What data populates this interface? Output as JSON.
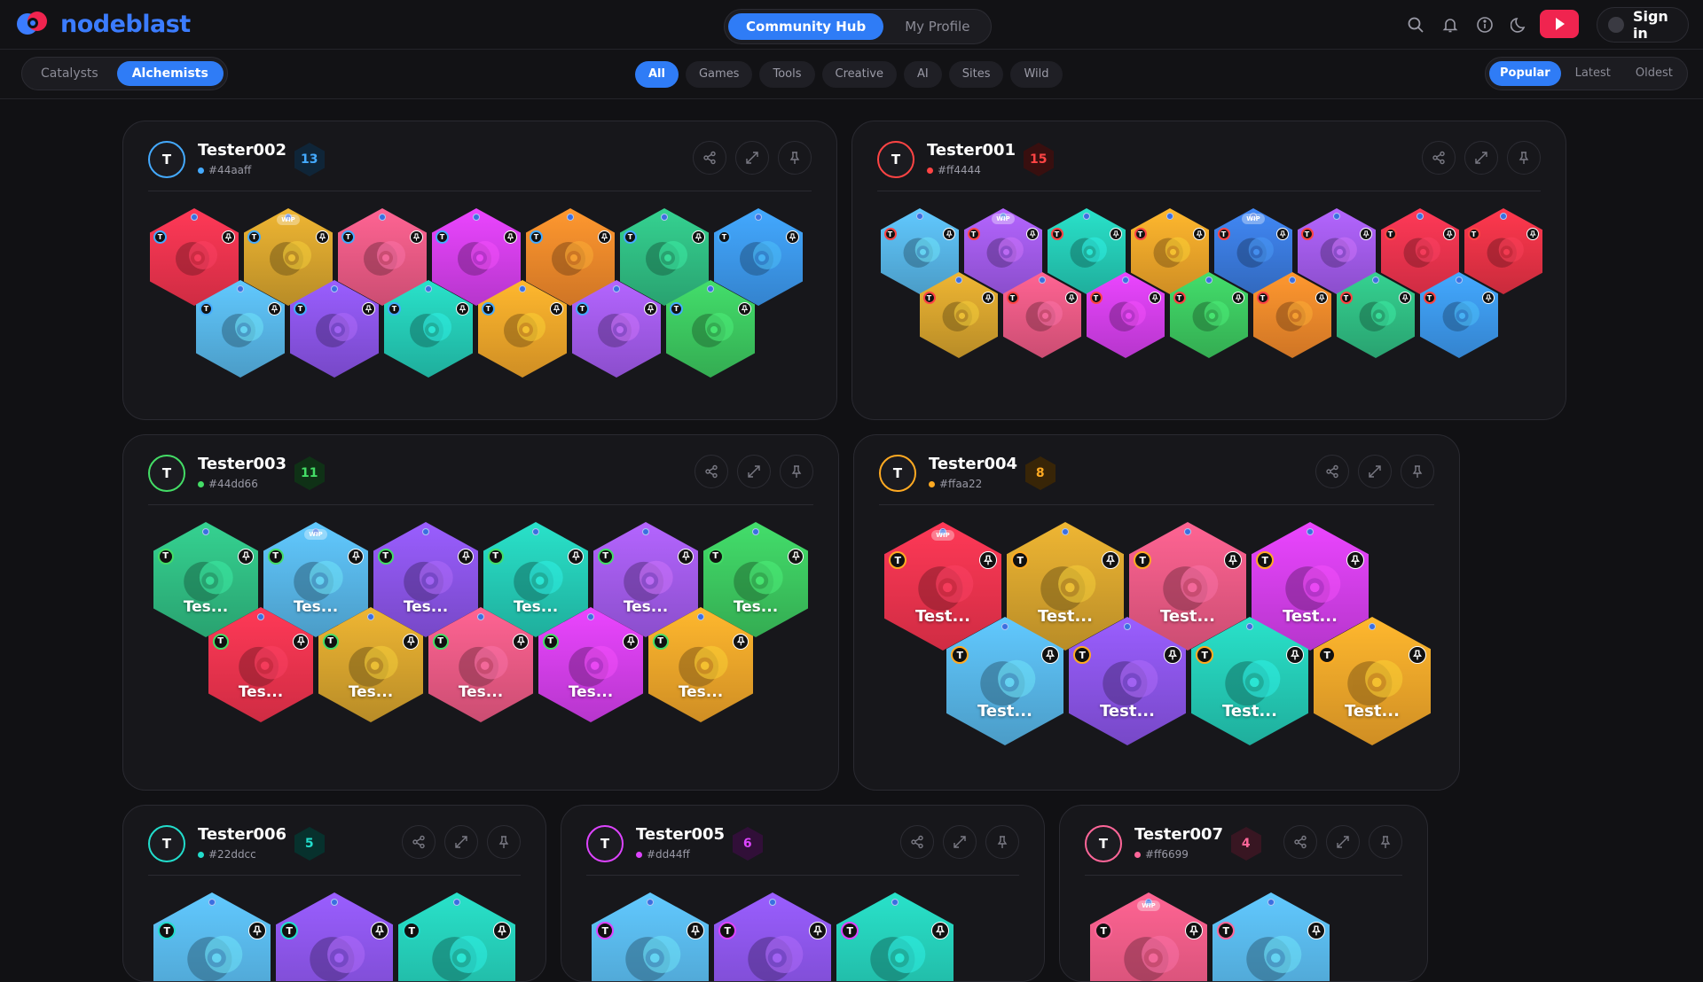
{
  "app": {
    "name": "nodeblast"
  },
  "header": {
    "tabs": [
      {
        "label": "Community Hub",
        "active": true
      },
      {
        "label": "My Profile",
        "active": false
      }
    ],
    "signin_label": "Sign in"
  },
  "roles": [
    {
      "label": "Catalysts",
      "active": false
    },
    {
      "label": "Alchemists",
      "active": true
    }
  ],
  "filters": [
    {
      "label": "All",
      "active": true
    },
    {
      "label": "Games",
      "active": false
    },
    {
      "label": "Tools",
      "active": false
    },
    {
      "label": "Creative",
      "active": false
    },
    {
      "label": "AI",
      "active": false
    },
    {
      "label": "Sites",
      "active": false
    },
    {
      "label": "Wild",
      "active": false
    }
  ],
  "sorts": [
    {
      "label": "Popular",
      "active": true
    },
    {
      "label": "Latest",
      "active": false
    },
    {
      "label": "Oldest",
      "active": false
    }
  ],
  "palette": {
    "red": "#f3344f",
    "gold": "#d9a52e",
    "pink": "#ef5b86",
    "magenta": "#d63ff0",
    "orange": "#f38a2b",
    "green": "#30bf84",
    "blue": "#3d9af2",
    "sky": "#58b7ea",
    "purple": "#8c55ea",
    "teal": "#25cdb8",
    "amber": "#f3a72a",
    "lime": "#3dca61",
    "violet": "#a45cf0",
    "royal": "#3b7ce0",
    "crimson": "#ec3347"
  },
  "cards": [
    {
      "user": "Tester002",
      "color": "#44aaff",
      "color_label": "#44aaff",
      "count": "13",
      "tiles": [
        {
          "c": "red"
        },
        {
          "c": "gold",
          "wip": true
        },
        {
          "c": "pink"
        },
        {
          "c": "magenta"
        },
        {
          "c": "orange"
        },
        {
          "c": "green"
        },
        {
          "c": "blue"
        },
        {
          "c": "sky"
        },
        {
          "c": "purple"
        },
        {
          "c": "teal"
        },
        {
          "c": "amber"
        },
        {
          "c": "violet"
        },
        {
          "c": "lime"
        }
      ]
    },
    {
      "user": "Tester001",
      "color": "#ff4444",
      "color_label": "#ff4444",
      "count": "15",
      "tiles": [
        {
          "c": "sky"
        },
        {
          "c": "violet",
          "wip": true
        },
        {
          "c": "teal"
        },
        {
          "c": "amber"
        },
        {
          "c": "royal",
          "wip": true
        },
        {
          "c": "violet"
        },
        {
          "c": "red"
        },
        {
          "c": "crimson"
        },
        {
          "c": "gold"
        },
        {
          "c": "pink"
        },
        {
          "c": "magenta"
        },
        {
          "c": "lime"
        },
        {
          "c": "orange"
        },
        {
          "c": "green"
        },
        {
          "c": "blue"
        }
      ]
    },
    {
      "user": "Tester003",
      "color": "#44dd66",
      "color_label": "#44dd66",
      "count": "11",
      "tiles": [
        {
          "c": "green",
          "t": "Tes..."
        },
        {
          "c": "sky",
          "t": "Tes...",
          "wip": true
        },
        {
          "c": "purple",
          "t": "Tes..."
        },
        {
          "c": "teal",
          "t": "Tes..."
        },
        {
          "c": "violet",
          "t": "Tes..."
        },
        {
          "c": "lime",
          "t": "Tes..."
        },
        {
          "c": "red",
          "t": "Tes..."
        },
        {
          "c": "gold",
          "t": "Tes..."
        },
        {
          "c": "pink",
          "t": "Tes..."
        },
        {
          "c": "magenta",
          "t": "Tes..."
        },
        {
          "c": "amber",
          "t": "Tes..."
        }
      ]
    },
    {
      "user": "Tester004",
      "color": "#ffaa22",
      "color_label": "#ffaa22",
      "count": "8",
      "tiles": [
        {
          "c": "red",
          "t": "Test...",
          "wip": true
        },
        {
          "c": "gold",
          "t": "Test..."
        },
        {
          "c": "pink",
          "t": "Test..."
        },
        {
          "c": "magenta",
          "t": "Test..."
        },
        {
          "c": "sky",
          "t": "Test..."
        },
        {
          "c": "purple",
          "t": "Test..."
        },
        {
          "c": "teal",
          "t": "Test..."
        },
        {
          "c": "amber",
          "t": "Test..."
        }
      ]
    },
    {
      "user": "Tester006",
      "color": "#22ddcc",
      "color_label": "#22ddcc",
      "count": "5",
      "tiles": [
        {
          "c": "sky"
        },
        {
          "c": "purple"
        },
        {
          "c": "teal"
        }
      ]
    },
    {
      "user": "Tester005",
      "color": "#dd44ff",
      "color_label": "#dd44ff",
      "count": "6",
      "tiles": [
        {
          "c": "sky"
        },
        {
          "c": "purple"
        },
        {
          "c": "teal"
        }
      ]
    },
    {
      "user": "Tester007",
      "color": "#ff6699",
      "color_label": "#ff6699",
      "count": "4",
      "tiles": [
        {
          "c": "pink",
          "wip": true
        },
        {
          "c": "sky"
        }
      ]
    }
  ],
  "labels": {
    "wip": "WIP",
    "badge": "T"
  },
  "icons": [
    "search-icon",
    "bell-icon",
    "info-icon",
    "moon-icon",
    "youtube-icon",
    "share-icon",
    "collapse-icon",
    "pin-icon",
    "node-logo-icon"
  ]
}
